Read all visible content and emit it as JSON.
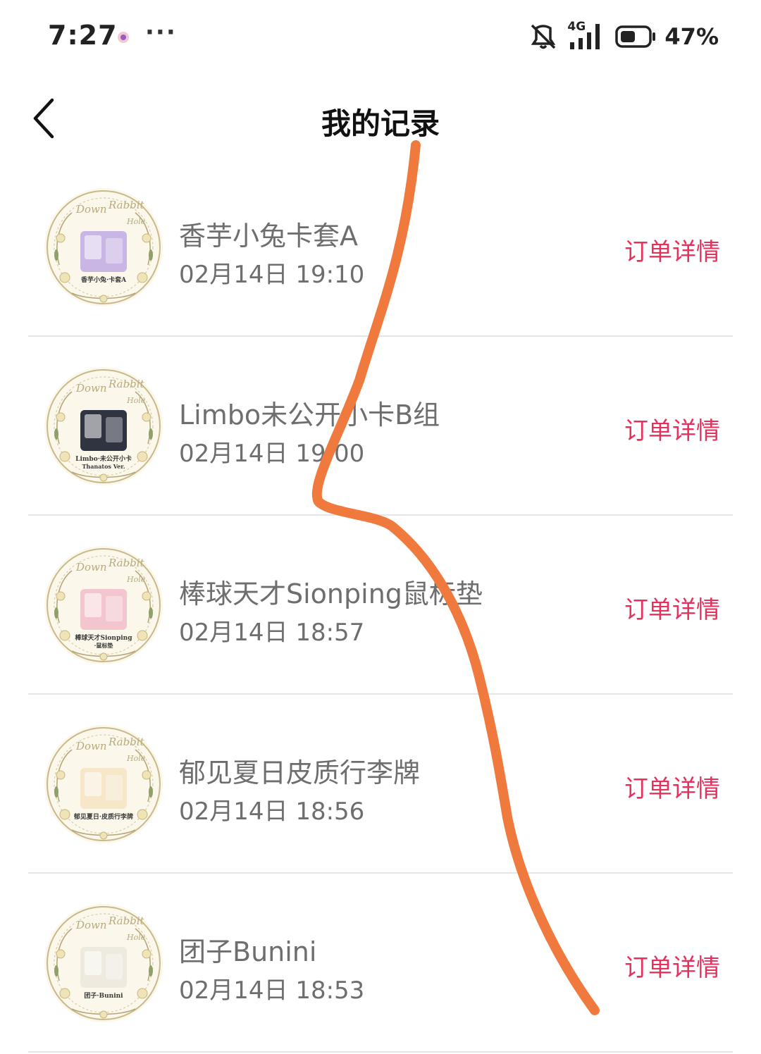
{
  "status_bar": {
    "time": "7:27",
    "dots": "···",
    "battery_percent": "47%",
    "network_label": "4G",
    "icons": [
      "app-notification-icon",
      "mute-icon",
      "signal-icon",
      "battery-icon"
    ]
  },
  "nav": {
    "title": "我的记录",
    "back_icon": "chevron-left-icon"
  },
  "records": [
    {
      "name": "香芋小兔卡套A",
      "time": "02月14日 19:10",
      "action": "订单详情",
      "thumb_caption": "香芋小兔·卡套A",
      "thumb_color": "#c9b6e4"
    },
    {
      "name": "Limbo未公开小卡B组",
      "time": "02月14日 19:00",
      "action": "订单详情",
      "thumb_caption": "Limbo·未公开小卡",
      "thumb_subcaption": "Thanatos Ver.",
      "thumb_color": "#2f3440"
    },
    {
      "name": "棒球天才Sionping鼠标垫",
      "time": "02月14日 18:57",
      "action": "订单详情",
      "thumb_caption": "棒球天才Sionping",
      "thumb_subcaption": "·鼠标垫",
      "thumb_color": "#f3c6cf"
    },
    {
      "name": "郁见夏日皮质行李牌",
      "time": "02月14日 18:56",
      "action": "订单详情",
      "thumb_caption": "郁见夏日·皮质行李牌",
      "thumb_color": "#f5e7c8"
    },
    {
      "name": "团子Bunini",
      "time": "02月14日 18:53",
      "action": "订单详情",
      "thumb_caption": "团子·Bunini",
      "thumb_color": "#eeeae0"
    }
  ],
  "colors": {
    "accent": "#e5315c",
    "text_secondary": "#6e6e6e",
    "divider": "#e6e6e6",
    "scribble": "#f07a3e",
    "badge_bg": "#fbf7ea",
    "badge_frame": "#c9b98a"
  }
}
